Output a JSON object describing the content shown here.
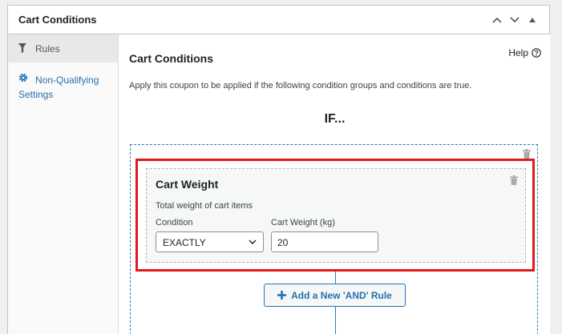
{
  "postbox": {
    "title": "Cart Conditions"
  },
  "tabs": {
    "rules_label": "Rules",
    "non_qualifying_label": "Non-Qualifying Settings"
  },
  "main": {
    "title": "Cart Conditions",
    "help_label": "Help",
    "intro": "Apply this coupon to be applied if the following condition groups and conditions are true.",
    "if_label": "IF..."
  },
  "rule": {
    "title": "Cart Weight",
    "description": "Total weight of cart items",
    "condition_label": "Condition",
    "condition_value": "EXACTLY",
    "weight_label": "Cart Weight (kg)",
    "weight_value": "20"
  },
  "add_rule_label": "Add a New 'AND' Rule",
  "colors": {
    "accent": "#2271b1",
    "highlight": "#e0191b",
    "group_border": "#2c7bb6"
  },
  "icons": {
    "rules_tab": "filter-icon",
    "non_qualifying_tab": "gear-icon",
    "help": "help-circle-icon",
    "trash": "trash-icon",
    "add": "plus-icon"
  }
}
